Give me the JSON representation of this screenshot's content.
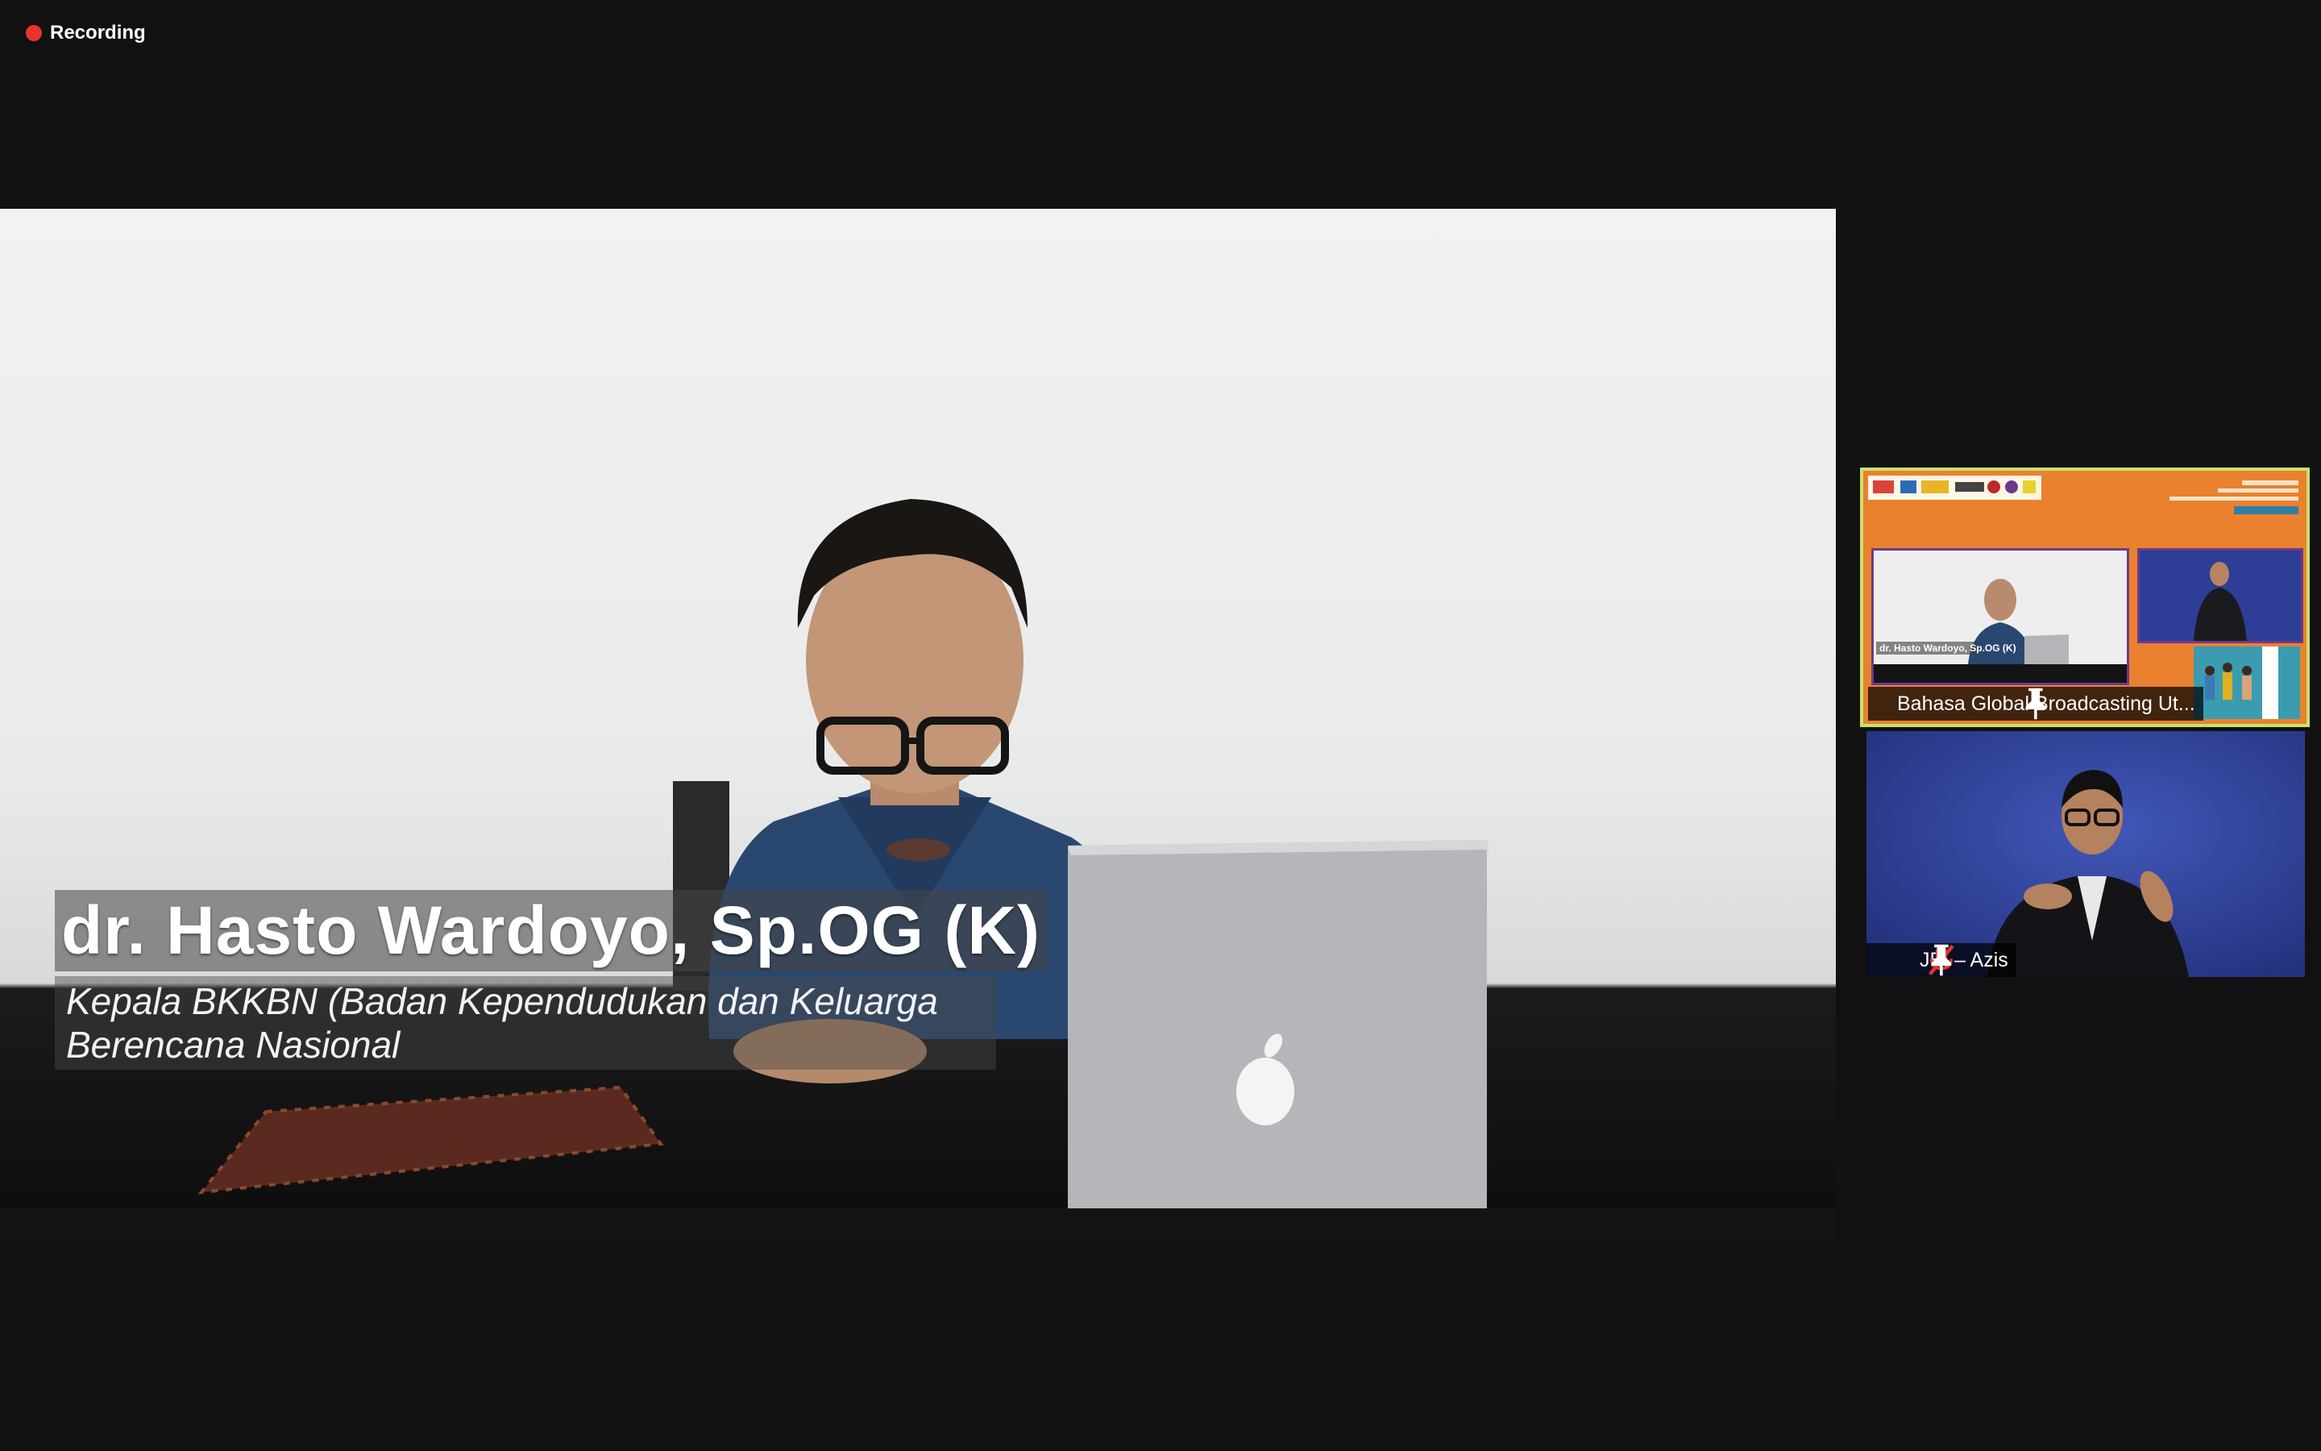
{
  "recording": {
    "label": "Recording"
  },
  "main_video": {
    "lower_third": {
      "name": "dr. Hasto Wardoyo, Sp.OG (K)",
      "title_line1": "Kepala BKKBN (Badan Kependudukan dan Keluarga",
      "title_line2": "Berencana Nasional"
    }
  },
  "participants": [
    {
      "name": "Bahasa Global Broadcasting Ut...",
      "icons": [
        "pin-icon"
      ],
      "active_speaker": true
    },
    {
      "name": "JBI – Azis",
      "icons": [
        "muted-mic-icon",
        "pin-icon"
      ],
      "active_speaker": false
    }
  ],
  "thumb": {
    "caption": "dr. Hasto Wardoyo, Sp.OG (K)"
  },
  "colors": {
    "background": "#111111",
    "recording_dot": "#e8332f",
    "active_speaker_border": "#c9e26a",
    "muted_icon": "#e8332f",
    "broadcast_bg": "#e9812f"
  }
}
